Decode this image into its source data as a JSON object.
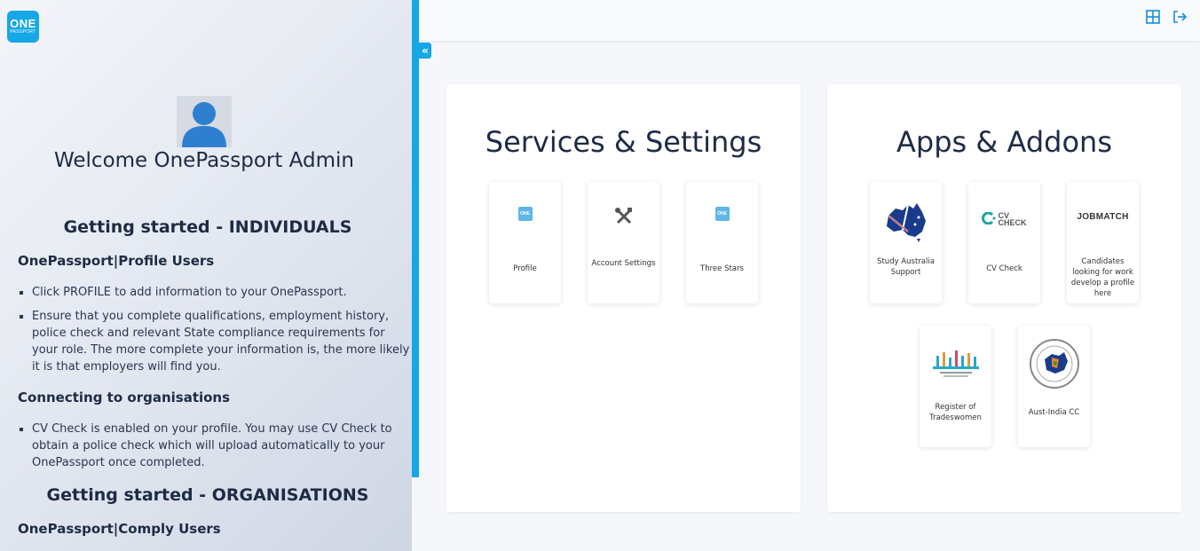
{
  "app": {
    "logo_line1": "ONE",
    "logo_line2": "PASSPORT"
  },
  "sidebar": {
    "welcome": "Welcome OnePassport Admin",
    "individuals_heading": "Getting started - INDIVIDUALS",
    "profile_users_heading": "OnePassport|Profile Users",
    "profile_bullets": [
      "Click PROFILE to add information to your OnePassport.",
      "Ensure that you complete qualifications, employment history, police check and relevant State compliance requirements for your role. The more complete your information is, the more likely it is that employers will find you."
    ],
    "connecting_heading": "Connecting to organisations",
    "connecting_bullets": [
      "CV Check is enabled on your profile. You may use CV Check to obtain a police check which will upload automatically to your OnePassport once completed."
    ],
    "organisations_heading": "Getting started - ORGANISATIONS",
    "comply_users_heading": "OnePassport|Comply Users",
    "collapse_glyph": "«"
  },
  "topbar": {
    "icons": [
      "grid-icon",
      "logout-icon"
    ]
  },
  "services": {
    "title": "Services & Settings",
    "cards": [
      {
        "label": "Profile",
        "icon": "onepassport-profile-icon"
      },
      {
        "label": "Account Settings",
        "icon": "tools-icon"
      },
      {
        "label": "Three Stars",
        "icon": "onepassport-company-icon"
      }
    ]
  },
  "apps": {
    "title": "Apps & Addons",
    "cards": [
      {
        "label": "Study Australia Support",
        "icon": "australia-map-icon"
      },
      {
        "label": "CV Check",
        "icon": "cv-check-logo",
        "logo_text_1": "CV",
        "logo_text_2": "CHECK"
      },
      {
        "label": "Candidates looking for work develop a profile here",
        "icon": "jobmatch-logo",
        "logo_text": "JOBMATCH"
      },
      {
        "label": "Register of Tradeswomen",
        "icon": "tradeswomen-logo"
      },
      {
        "label": "Aust-India CC",
        "icon": "aust-india-seal-logo"
      }
    ]
  },
  "colors": {
    "accent": "#16a7e6",
    "text": "#1e2b45"
  }
}
